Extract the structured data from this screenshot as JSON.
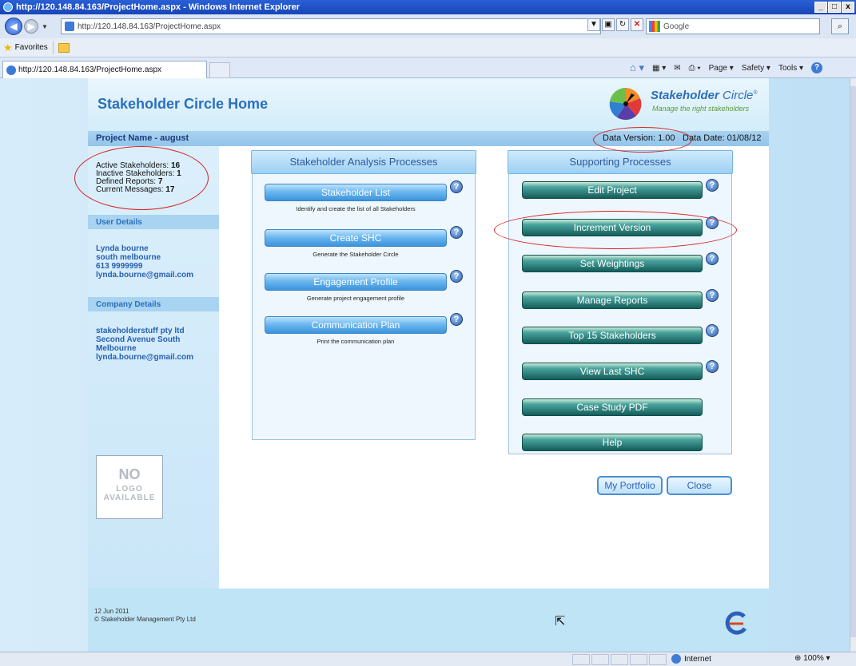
{
  "browser": {
    "title": "http://120.148.84.163/ProjectHome.aspx - Windows Internet Explorer",
    "address": "http://120.148.84.163/ProjectHome.aspx",
    "search_placeholder": "Google",
    "favorites_label": "Favorites",
    "tab_title": "http://120.148.84.163/ProjectHome.aspx",
    "cmd_page": "Page ▾",
    "cmd_safety": "Safety ▾",
    "cmd_tools": "Tools ▾",
    "status_zone": "Internet",
    "status_zoom": "100%"
  },
  "header": {
    "title": "Stakeholder Circle Home",
    "brand": "Stakeholder",
    "brand_circle": "Circle",
    "brand_reg": "®",
    "tagline": "Manage the right stakeholders"
  },
  "project": {
    "name": "Project Name - august",
    "data_version": "Data Version: 1.00",
    "data_date": "Data Date: 01/08/12"
  },
  "stats": [
    {
      "label": "Active Stakeholders:",
      "value": "16"
    },
    {
      "label": "Inactive Stakeholders:",
      "value": "1"
    },
    {
      "label": "Defined Reports:",
      "value": "7"
    },
    {
      "label": "Current Messages:",
      "value": "17"
    }
  ],
  "user": {
    "heading": "User Details",
    "name": "Lynda bourne",
    "city": "south melbourne",
    "phone": "613 9999999",
    "email": "lynda.bourne@gmail.com"
  },
  "company": {
    "heading": "Company Details",
    "name": "stakeholderstuff pty ltd",
    "address1": "Second Avenue South",
    "address2": "Melbourne",
    "email": "lynda.bourne@gmail.com"
  },
  "no_logo": {
    "line1": "NO",
    "line2": "LOGO",
    "line3": "AVAILABLE"
  },
  "analysis": {
    "heading": "Stakeholder Analysis Processes",
    "items": [
      {
        "label": "Stakeholder List",
        "desc": "Identify and create the list of all Stakeholders"
      },
      {
        "label": "Create SHC",
        "desc": "Generate the Stakeholder Circle"
      },
      {
        "label": "Engagement Profile",
        "desc": "Generate project engagement profile"
      },
      {
        "label": "Communication Plan",
        "desc": "Print the communication plan"
      }
    ]
  },
  "supporting": {
    "heading": "Supporting Processes",
    "items": [
      {
        "label": "Edit Project"
      },
      {
        "label": "Increment Version"
      },
      {
        "label": "Set Weightings"
      },
      {
        "label": "Manage Reports"
      },
      {
        "label": "Top 15 Stakeholders"
      },
      {
        "label": "View Last SHC"
      },
      {
        "label": "Case Study PDF"
      },
      {
        "label": "Help"
      }
    ]
  },
  "actions": {
    "portfolio": "My Portfolio",
    "close": "Close"
  },
  "footer": {
    "date": "12 Jun 2011",
    "copyright": "© Stakeholder Management Pty Ltd"
  },
  "help_glyph": "?",
  "colors": {
    "link_blue": "#2860b0",
    "annotation_red": "#d62020",
    "teal_button": "#145c5a"
  }
}
